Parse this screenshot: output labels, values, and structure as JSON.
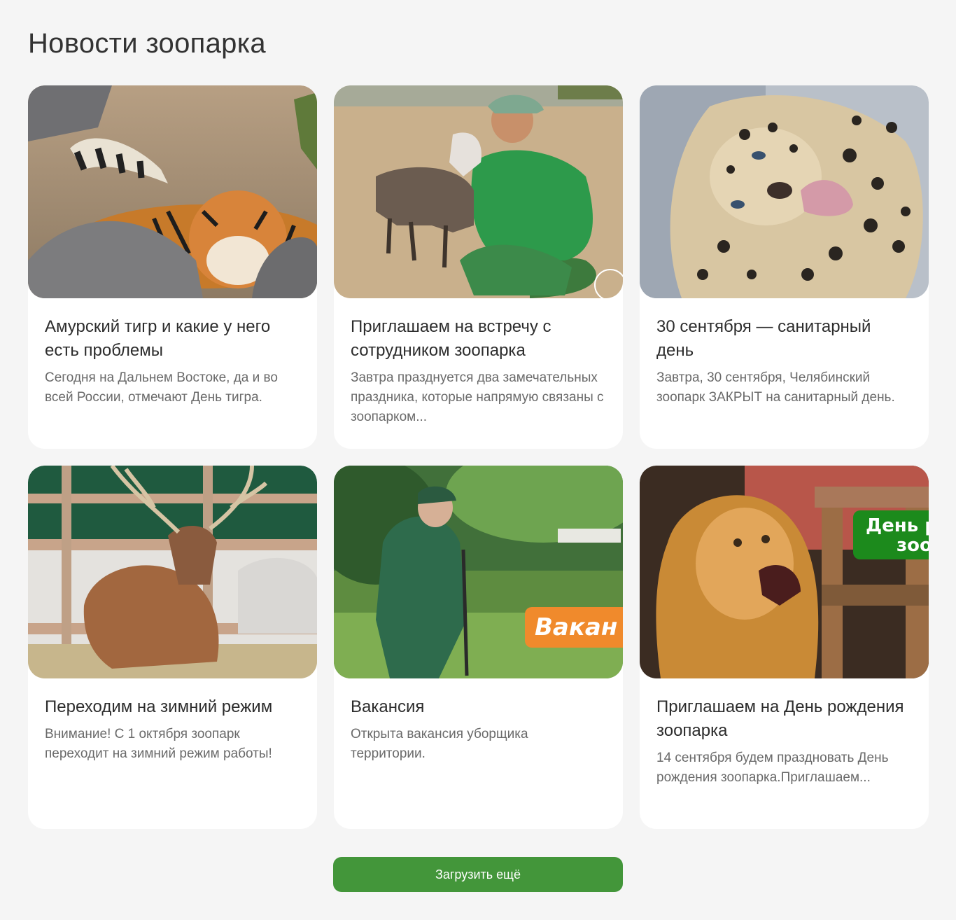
{
  "page": {
    "title": "Новости зоопарка"
  },
  "news": [
    {
      "title": "Амурский тигр и какие у него есть проблемы",
      "text": "Сегодня на Дальнем Востоке, да и во всей России, отмечают День тигра.",
      "image": "tiger-photo"
    },
    {
      "title": "Приглашаем на встречу с сотрудником зоопарка",
      "text": "Завтра празднуется два замечательных праздника, которые напрямую связаны с зоопарком...",
      "image": "keeper-goat-photo"
    },
    {
      "title": "30 сентября — санитарный день",
      "text": "Завтра, 30 сентября, Челябинский зоопарк ЗАКРЫТ на санитарный день.",
      "image": "leopard-photo"
    },
    {
      "title": "Переходим на зимний режим",
      "text": "Внимание! С 1 октября зоопарк переходит на зимний режим работы!",
      "image": "deer-photo"
    },
    {
      "title": "Вакансия",
      "text": "Открыта вакансия уборщика территории.",
      "image": "worker-photo",
      "badge": "Вакан"
    },
    {
      "title": "Приглашаем на День рождения зоопарка",
      "text": "14 сентября будем праздновать День рождения зоопарка.Приглашаем...",
      "image": "lion-photo",
      "badge_line1": "День р",
      "badge_line2": "зоо"
    }
  ],
  "load_more": {
    "label": "Загрузить ещё"
  },
  "colors": {
    "background": "#f5f5f5",
    "card": "#ffffff",
    "accent_green": "#43963a",
    "badge_orange": "#f08a2c",
    "badge_green": "#1c8a1c"
  }
}
